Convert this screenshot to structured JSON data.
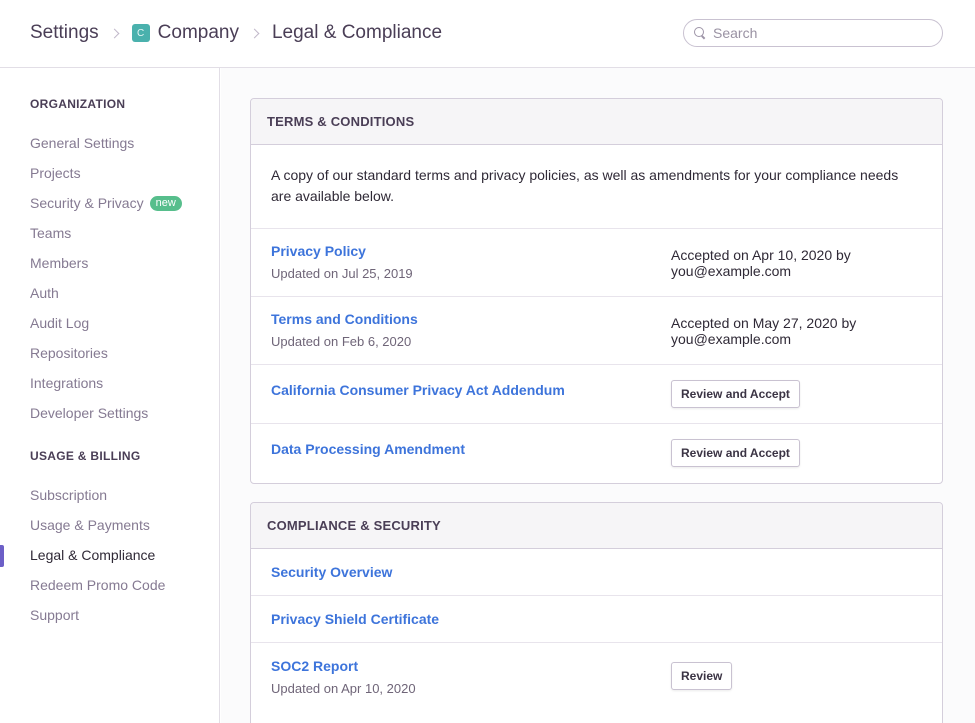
{
  "header": {
    "breadcrumbs": [
      "Settings",
      "Company",
      "Legal & Compliance"
    ],
    "org_badge": "C",
    "search_placeholder": "Search"
  },
  "sidebar": {
    "sections": [
      {
        "heading": "ORGANIZATION",
        "items": [
          {
            "label": "General Settings"
          },
          {
            "label": "Projects"
          },
          {
            "label": "Security & Privacy",
            "badge": "new"
          },
          {
            "label": "Teams"
          },
          {
            "label": "Members"
          },
          {
            "label": "Auth"
          },
          {
            "label": "Audit Log"
          },
          {
            "label": "Repositories"
          },
          {
            "label": "Integrations"
          },
          {
            "label": "Developer Settings"
          }
        ]
      },
      {
        "heading": "USAGE & BILLING",
        "items": [
          {
            "label": "Subscription"
          },
          {
            "label": "Usage & Payments"
          },
          {
            "label": "Legal & Compliance",
            "active": true
          },
          {
            "label": "Redeem Promo Code"
          },
          {
            "label": "Support"
          }
        ]
      }
    ]
  },
  "terms_panel": {
    "title": "TERMS & CONDITIONS",
    "intro": "A copy of our standard terms and privacy policies, as well as amendments for your compliance needs are available below.",
    "rows": [
      {
        "link": "Privacy Policy",
        "updated": "Updated on Jul 25, 2019",
        "status_line1": "Accepted on Apr 10, 2020 by",
        "status_line2": "you@example.com"
      },
      {
        "link": "Terms and Conditions",
        "updated": "Updated on Feb 6, 2020",
        "status_line1": "Accepted on May 27, 2020 by",
        "status_line2": "you@example.com"
      },
      {
        "link": "California Consumer Privacy Act Addendum",
        "button": "Review and Accept"
      },
      {
        "link": "Data Processing Amendment",
        "button": "Review and Accept"
      }
    ]
  },
  "compliance_panel": {
    "title": "COMPLIANCE & SECURITY",
    "rows": [
      {
        "link": "Security Overview"
      },
      {
        "link": "Privacy Shield Certificate"
      },
      {
        "link": "SOC2 Report",
        "updated": "Updated on Apr 10, 2020",
        "button": "Review"
      }
    ]
  },
  "colors": {
    "link": "#3d74db",
    "active_indicator": "#6c5fc7",
    "new_badge": "#57be8c",
    "org_badge": "#4ab1ad"
  }
}
